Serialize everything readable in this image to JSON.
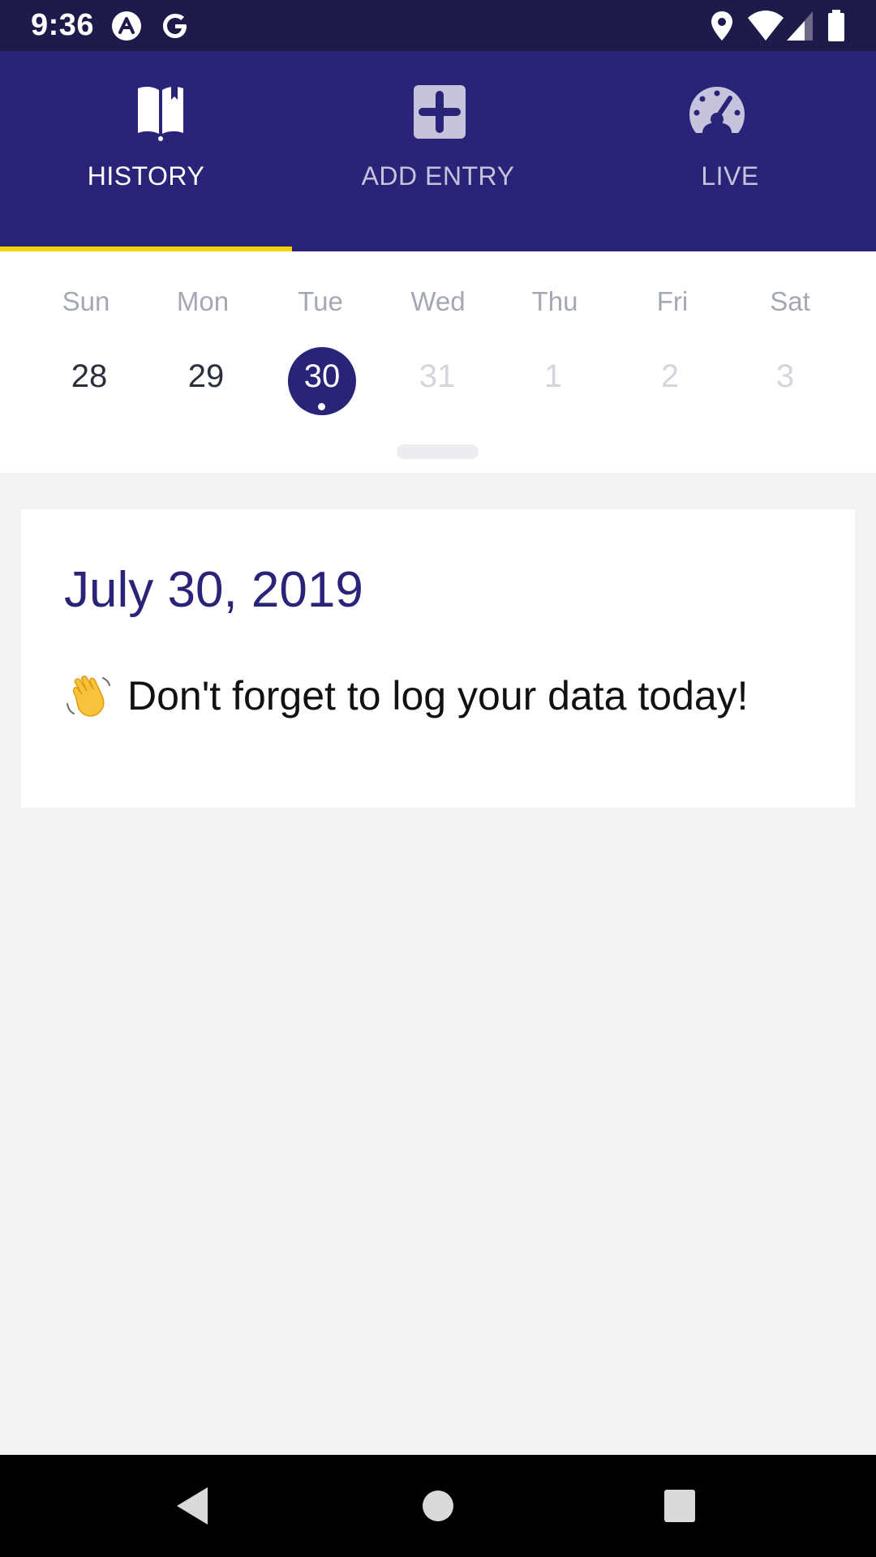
{
  "status_bar": {
    "time": "9:36",
    "icons": [
      "app-notification-icon",
      "google-icon",
      "location-icon",
      "wifi-icon",
      "cell-signal-icon",
      "battery-icon"
    ]
  },
  "tabs": [
    {
      "label": "HISTORY",
      "icon": "book-icon",
      "active": true
    },
    {
      "label": "ADD ENTRY",
      "icon": "plus-square-icon",
      "active": false
    },
    {
      "label": "LIVE",
      "icon": "speedometer-icon",
      "active": false
    }
  ],
  "week": {
    "days": [
      {
        "name": "Sun",
        "num": "28",
        "state": "past"
      },
      {
        "name": "Mon",
        "num": "29",
        "state": "past"
      },
      {
        "name": "Tue",
        "num": "30",
        "state": "selected"
      },
      {
        "name": "Wed",
        "num": "31",
        "state": "future"
      },
      {
        "name": "Thu",
        "num": "1",
        "state": "future"
      },
      {
        "name": "Fri",
        "num": "2",
        "state": "future"
      },
      {
        "name": "Sat",
        "num": "3",
        "state": "future"
      }
    ]
  },
  "card": {
    "date": "July 30, 2019",
    "message": "Don't forget to log your data today!",
    "emoji": "waving-hand-icon"
  },
  "colors": {
    "status_bar": "#1e1b4a",
    "primary": "#2a2478",
    "indicator": "#f5d400",
    "background": "#f3f3f3"
  },
  "nav": [
    "back-icon",
    "home-icon",
    "recents-icon"
  ]
}
